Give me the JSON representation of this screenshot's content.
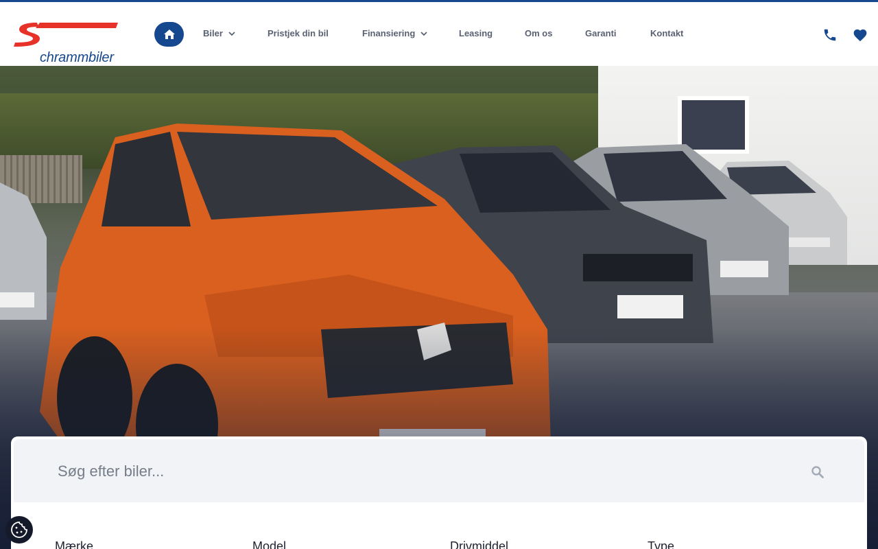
{
  "brand": {
    "name": "Schrammbiler",
    "logo_text": "chrammbiler",
    "primary_color": "#16488f",
    "accent_color": "#e63228"
  },
  "nav": {
    "home_icon": "home-icon",
    "items": [
      {
        "label": "Biler",
        "has_dropdown": true
      },
      {
        "label": "Pristjek din bil",
        "has_dropdown": false
      },
      {
        "label": "Finansiering",
        "has_dropdown": true
      },
      {
        "label": "Leasing",
        "has_dropdown": false
      },
      {
        "label": "Om os",
        "has_dropdown": false
      },
      {
        "label": "Garanti",
        "has_dropdown": false
      },
      {
        "label": "Kontakt",
        "has_dropdown": false
      }
    ],
    "actions": [
      {
        "icon": "phone-icon"
      },
      {
        "icon": "heart-icon"
      }
    ]
  },
  "hero": {
    "image": "cars-on-dealer-lot"
  },
  "search": {
    "placeholder": "Søg efter biler...",
    "icon": "search-icon"
  },
  "filters": {
    "labels": [
      "Mærke",
      "Model",
      "Drivmiddel",
      "Type"
    ]
  },
  "cookie": {
    "icon": "cookie-icon"
  }
}
